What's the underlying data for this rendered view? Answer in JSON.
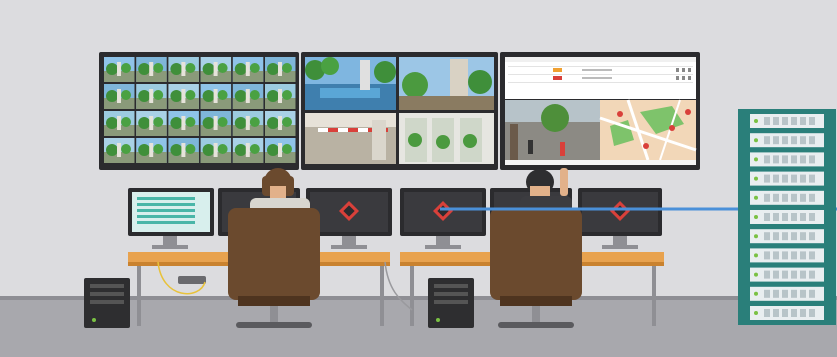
{
  "scene": {
    "description_free": true,
    "colors": {
      "wall": "#dcdcdf",
      "floor": "#a8a8ad",
      "floor_edge": "#8e8e94",
      "monitor_bezel": "#2b2b2e",
      "desk_top": "#e8a24e",
      "desk_edge": "#c9822f",
      "desk_leg": "#8f8f94",
      "chair": "#6b4a2e",
      "chair_dark": "#4e341f",
      "server_rack": "#2a7f7a",
      "server_unit": "#e9eef0",
      "network_line": "#4a90d9",
      "pc_tower": "#2e2e30",
      "status_green": "#7ac143",
      "status_red": "#d9403a",
      "accent_orange": "#f0a030"
    },
    "icons": {
      "video_wall": "cctv-grid-icon",
      "map_panel": "map-icon",
      "server": "server-rack-icon",
      "operator_station": "workstation-icon"
    }
  }
}
